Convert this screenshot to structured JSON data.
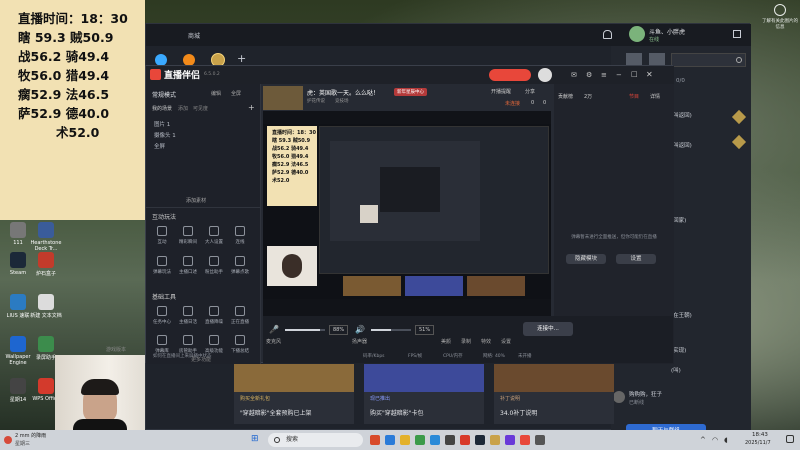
{
  "overlay_stats": {
    "time_line": "直播时间：18：30",
    "rows": [
      "瞎 59.3  贼50.9",
      "战56.2  骑49.4",
      "牧56.0  猎49.4",
      "瘸52.9  法46.5",
      "萨52.9  德40.0",
      "术52.0"
    ]
  },
  "back_window": {
    "tab_label": "商城",
    "user_name": "斗鱼、小胖虎",
    "user_status": "在线",
    "search_icon": "search-icon",
    "notice_count": "0/0",
    "right_snippets": [
      "(叫返回)",
      "(叫返回)",
      "(回家)",
      "(在王朝)",
      "(实现)",
      "(叫)"
    ],
    "promos": [
      {
        "tag": "购买全新礼包",
        "title": "\"穿越暗影\"全套预购已上架",
        "color": "#c9a24a"
      },
      {
        "tag": "现已推出",
        "title": "购买\"穿越暗影\"卡包",
        "color": "#5a6bd1"
      },
      {
        "tag": "补丁说明",
        "title": "34.0补丁说明",
        "color": "#8a5a3a"
      }
    ],
    "version_label": "游戏版本",
    "friend_label": "购购购，狂子",
    "friend_sub": "已断线",
    "chat_button": "聊天与群组"
  },
  "front_window": {
    "app_title": "直播伴侣",
    "version": "6.5.0.2",
    "mode_label": "常规模式",
    "edit_label": "编辑",
    "fullscreen_label": "全屏",
    "section_my_scenes": "我的场景",
    "scene_actions": [
      "添加",
      "可见度"
    ],
    "scenes": [
      "图片 1",
      "摄像头 1",
      "全屏"
    ],
    "add_material": "添加素材",
    "interactive_tools_title": "互动玩法",
    "interactive_tools": [
      "互动",
      "精彩瞬间",
      "大人设置",
      "连线"
    ],
    "more_tools_row": [
      "弹幕玩法",
      "主播口述",
      "粉丝助手",
      "弹幕点歌"
    ],
    "basic_tools_title": "基础工具",
    "basic_tools": [
      "任务中心",
      "主播日活",
      "直播降噪",
      "正在直播"
    ],
    "basic_tools_2": [
      "弹幕库",
      "房管助手",
      "高级功能",
      "下播总结"
    ],
    "more_features": "更多功能",
    "room_title": "虎：英国歌一天。么么哒！",
    "room_badge": "新年星辰中心",
    "room_sub": [
      "护花传说",
      "竞技场"
    ],
    "top_actions": [
      "开播提醒",
      "分享"
    ],
    "status_badge": "未连接",
    "counts": [
      "0",
      "0"
    ],
    "right_tabs": [
      "贡献榜",
      "2万",
      "节目",
      "详情"
    ],
    "right_empty_text": "弹幕暂未进行全面推送，但你可能仍在直播",
    "right_buttons": [
      "隐藏模块",
      "设置"
    ],
    "mic_label": "麦克风",
    "mic_percent": "88%",
    "speaker_label": "扬声器",
    "speaker_percent": "51%",
    "bottom_icons": [
      "美颜",
      "录制",
      "特效",
      "设置"
    ],
    "start_button": "连接中...",
    "status_bar": [
      "如何在直播间上来屏播中状态",
      "码率/Kbps",
      "FPS/帧",
      "CPU/内存",
      "网络: 40%",
      "未开播"
    ]
  },
  "desktop_icons": [
    "111",
    "Hearthstone Deck Tr...",
    "Steam",
    "炉石盒子",
    "LIUS 速联",
    "新建 文本文档",
    "Wallpaper Engine",
    "录屏助手",
    "星期14",
    "WPS Office"
  ],
  "taskbar": {
    "weather": "2 mm 的降雨",
    "weather_sub": "星期三",
    "search_placeholder": "搜索",
    "time": "18:43",
    "date": "2025/11/7"
  },
  "corner_notice": "了解有关此图片的信息"
}
